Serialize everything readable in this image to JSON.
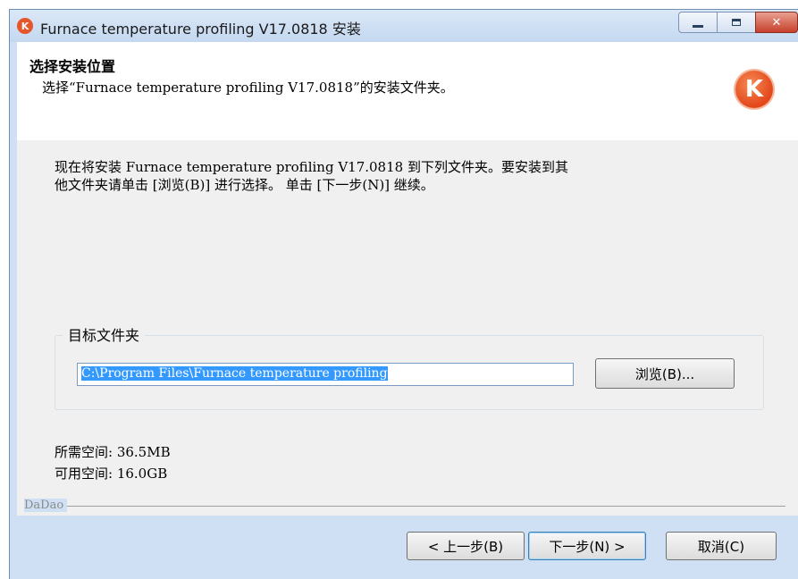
{
  "window": {
    "title": "Furnace temperature profiling V17.0818 安装",
    "app_icon_glyph": "K",
    "controls": {
      "minimize": "",
      "maximize": "",
      "close": "✕"
    }
  },
  "header": {
    "title": "选择安装位置",
    "subtitle": "选择“Furnace temperature profiling V17.0818”的安装文件夹。",
    "logo_glyph": "K"
  },
  "body": {
    "description_line1": "现在将安装 Furnace temperature profiling V17.0818 到下列文件夹。要安装到其",
    "description_line2": "他文件夹请单击 [浏览(B)] 进行选择。 单击 [下一步(N)] 继续。",
    "destination_group_label": "目标文件夹",
    "destination_path": "C:\\Program Files\\Furnace temperature profiling",
    "browse_button": "浏览(B)...",
    "space_required": "所需空间: 36.5MB",
    "space_available": "可用空间: 16.0GB"
  },
  "footer": {
    "brand": "DaDao",
    "back_button": "< 上一步(B)",
    "next_button": "下一步(N) >",
    "cancel_button": "取消(C)"
  },
  "colors": {
    "title_bar": "#c4d8f0",
    "close_button": "#c6402b",
    "logo": "#e3461a",
    "selection": "#3399ff"
  }
}
